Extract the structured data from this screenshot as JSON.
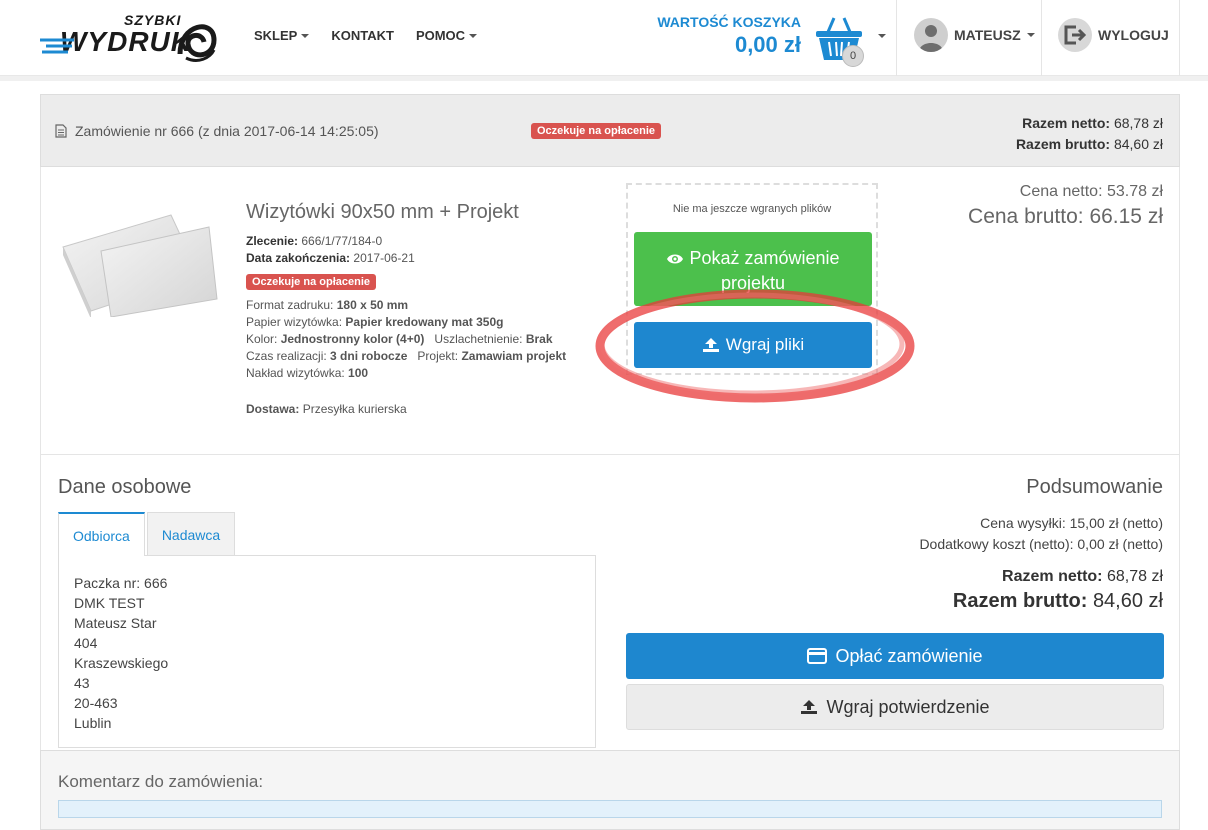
{
  "header": {
    "logo_small": "SZYBKI",
    "logo_big": "WYDRUK",
    "nav": [
      {
        "label": "SKLEP",
        "dropdown": true
      },
      {
        "label": "KONTAKT",
        "dropdown": false
      },
      {
        "label": "POMOC",
        "dropdown": true
      }
    ],
    "cart_label": "WARTOŚĆ KOSZYKA",
    "cart_value": "0,00 zł",
    "cart_count": "0",
    "user_name": "MATEUSZ",
    "logout_label": "WYLOGUJ",
    "accent_color": "#1d8ad2"
  },
  "order": {
    "title": "Zamówienie nr 666 (z dnia 2017-06-14 14:25:05)",
    "status": "Oczekuje na opłacenie",
    "total_netto_label": "Razem netto:",
    "total_netto": "68,78 zł",
    "total_brutto_label": "Razem brutto:",
    "total_brutto": "84,60 zł"
  },
  "product": {
    "name": "Wizytówki 90x50 mm + Projekt",
    "zlecenie_label": "Zlecenie:",
    "zlecenie": "666/1/77/184-0",
    "data_label": "Data zakończenia:",
    "data": "2017-06-21",
    "status": "Oczekuje na opłacenie",
    "format_label": "Format zadruku:",
    "format": "180 x 50 mm",
    "papier_label": "Papier wizytówka:",
    "papier": "Papier kredowany mat 350g",
    "kolor_label": "Kolor:",
    "kolor": "Jednostronny kolor (4+0)",
    "uszl_label": "Uszlachetnienie:",
    "uszl": "Brak",
    "czas_label": "Czas realizacji:",
    "czas": "3 dni robocze",
    "projekt_label": "Projekt:",
    "projekt": "Zamawiam projekt",
    "naklad_label": "Nakład wizytówka:",
    "naklad": "100",
    "dostawa_label": "Dostawa:",
    "dostawa": "Przesyłka kurierska",
    "price_netto": "Cena netto: 53.78 zł",
    "price_brutto": "Cena brutto: 66.15 zł"
  },
  "upload": {
    "note": "Nie ma jeszcze wgranych plików",
    "show_project_button": "Pokaż zamówienie projektu",
    "upload_button": "Wgraj pliki"
  },
  "personal": {
    "heading": "Dane osobowe",
    "tabs": [
      "Odbiorca",
      "Nadawca"
    ],
    "address_lines": [
      "Paczka nr: 666",
      "DMK TEST",
      "Mateusz Star",
      "404",
      "Kraszewskiego",
      "43",
      "20-463",
      "Lublin"
    ]
  },
  "summary": {
    "heading": "Podsumowanie",
    "shipping": "Cena wysyłki: 15,00 zł (netto)",
    "extra": "Dodatkowy koszt (netto): 0,00 zł (netto)",
    "netto_label": "Razem netto:",
    "netto": "68,78 zł",
    "brutto_label": "Razem brutto:",
    "brutto": "84,60 zł",
    "pay_button": "Opłać zamówienie",
    "confirm_button": "Wgraj potwierdzenie"
  },
  "comment": {
    "label": "Komentarz do zamówienia:"
  }
}
